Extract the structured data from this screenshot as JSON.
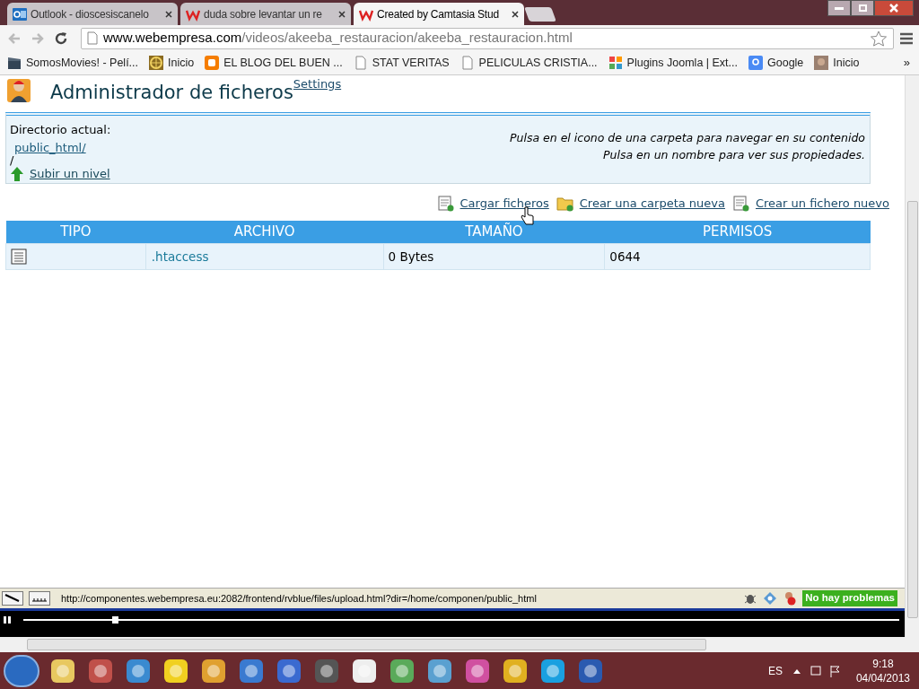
{
  "tabs": [
    {
      "title": "Outlook - dioscesiscanelo",
      "selected": false
    },
    {
      "title": "duda sobre levantar un re",
      "selected": false
    },
    {
      "title": "Created by Camtasia Stud",
      "selected": true
    }
  ],
  "address": {
    "host": "www.webempresa.com",
    "path": "/videos/akeeba_restauracion/akeeba_restauracion.html"
  },
  "bookmarks": [
    "SomosMovies! - Pelí...",
    "Inicio",
    "EL BLOG DEL BUEN ...",
    "STAT VERITAS",
    "PELICULAS CRISTIA...",
    "Plugins Joomla | Ext...",
    "Google",
    "Inicio"
  ],
  "bookmarks_overflow": "»",
  "page": {
    "title": "Administrador de ficheros",
    "settings_link": "Settings",
    "directory_label": "Directorio actual:",
    "directory_link": "public_html/",
    "directory_root": "/",
    "up_link": "Subir un nivel",
    "hints": [
      "Pulsa en el icono de una carpeta para navegar en su contenido",
      "Pulsa en un nombre para ver sus propiedades."
    ],
    "actions": [
      "Cargar ficheros",
      "Crear una carpeta nueva",
      "Crear un fichero nuevo"
    ],
    "columns": [
      "TIPO",
      "ARCHIVO",
      "TAMAÑO",
      "PERMISOS"
    ],
    "rows": [
      {
        "name": ".htaccess",
        "size": "0 Bytes",
        "permissions": "0644"
      }
    ]
  },
  "status_bar": {
    "url": "http://componentes.webempresa.eu:2082/frontend/rvblue/files/upload.html?dir=/home/componen/public_html",
    "badge": "No hay problemas"
  },
  "player": {
    "level": 0.105
  },
  "taskbar": {
    "language": "ES",
    "time": "9:18",
    "date": "04/04/2013"
  }
}
